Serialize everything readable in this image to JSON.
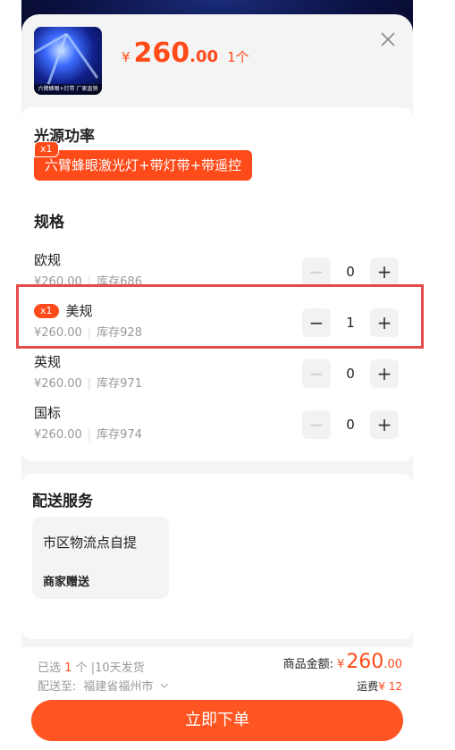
{
  "colors": {
    "accent": "#ff4a1a",
    "highlight": "#e54b4b"
  },
  "product": {
    "thumb_caption": "六臂蜂眼+灯带  厂家直销",
    "price_currency": "¥",
    "price_int": "260",
    "price_dec": ".00",
    "quantity": "1个"
  },
  "light_power": {
    "title": "光源功率",
    "selected_tag": "x1",
    "selected_label": "六臂蜂眼激光灯+带灯带+带遥控"
  },
  "specs": {
    "title": "规格",
    "items": [
      {
        "name": "欧规",
        "price": "¥260.00",
        "stock": "库存686",
        "minus": "−",
        "qty": "0",
        "plus": "+",
        "badge": ""
      },
      {
        "name": "美规",
        "price": "¥260.00",
        "stock": "库存928",
        "minus": "−",
        "qty": "1",
        "plus": "+",
        "badge": "x1"
      },
      {
        "name": "英规",
        "price": "¥260.00",
        "stock": "库存971",
        "minus": "−",
        "qty": "0",
        "plus": "+",
        "badge": ""
      },
      {
        "name": "国标",
        "price": "¥260.00",
        "stock": "库存974",
        "minus": "−",
        "qty": "0",
        "plus": "+",
        "badge": ""
      }
    ]
  },
  "delivery": {
    "title": "配送服务",
    "option": "市区物流点自提",
    "note": "商家赠送"
  },
  "footer": {
    "selected_prefix": "已选",
    "selected_count": "1",
    "selected_suffix": "个 |10天发货",
    "ship_to_label": "配送至:",
    "ship_to_addr": "福建省福州市",
    "total_label": "商品金额:",
    "total_currency": "¥",
    "total_int": "260",
    "total_dec": ".00",
    "shipping_label": "运费",
    "shipping_value": "¥ 12",
    "buy_label": "立即下单"
  }
}
